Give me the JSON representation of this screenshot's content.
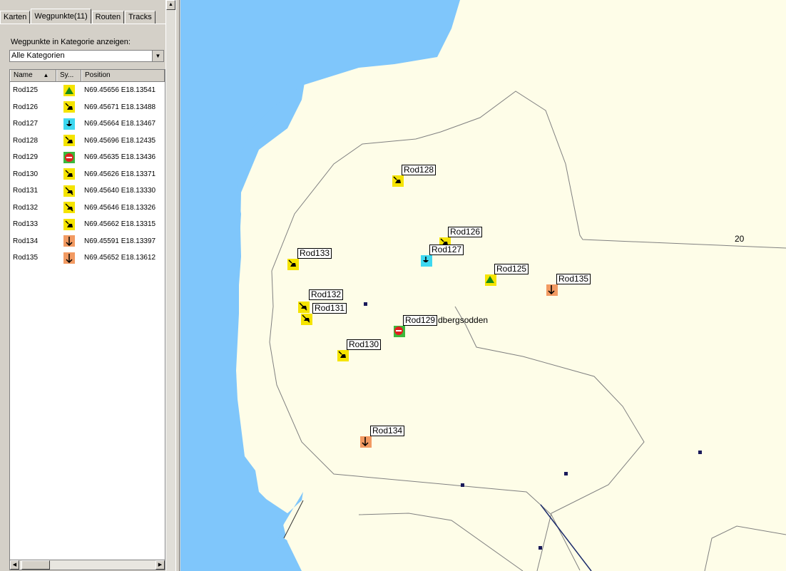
{
  "tabs": [
    {
      "label": "Karten"
    },
    {
      "label": "Wegpunkte(11)"
    },
    {
      "label": "Routen"
    },
    {
      "label": "Tracks"
    }
  ],
  "waypoints_panel": {
    "category_label": "Wegpunkte in Kategorie anzeigen:",
    "category_value": "Alle Kategorien",
    "columns": {
      "name": "Name",
      "symbol": "Sy...",
      "position": "Position"
    },
    "rows": [
      {
        "name": "Rod125",
        "symbol": "park-icon",
        "position": "N69.45656 E18.13541"
      },
      {
        "name": "Rod126",
        "symbol": "dog-icon",
        "position": "N69.45671 E18.13488"
      },
      {
        "name": "Rod127",
        "symbol": "drinking-water-icon",
        "position": "N69.45664 E18.13467"
      },
      {
        "name": "Rod128",
        "symbol": "dog-icon",
        "position": "N69.45696 E18.12435"
      },
      {
        "name": "Rod129",
        "symbol": "no-entry-icon",
        "position": "N69.45635 E18.13436"
      },
      {
        "name": "Rod130",
        "symbol": "dog-icon",
        "position": "N69.45626 E18.13371"
      },
      {
        "name": "Rod131",
        "symbol": "no-dogs-icon",
        "position": "N69.45640 E18.13330"
      },
      {
        "name": "Rod132",
        "symbol": "no-dogs-icon",
        "position": "N69.45646 E18.13326"
      },
      {
        "name": "Rod133",
        "symbol": "dog-icon",
        "position": "N69.45662 E18.13315"
      },
      {
        "name": "Rod134",
        "symbol": "anchor-icon",
        "position": "N69.45591 E18.13397"
      },
      {
        "name": "Rod135",
        "symbol": "anchor-icon",
        "position": "N69.45652 E18.13612"
      }
    ]
  },
  "map": {
    "place_name": "dbergsodden",
    "contour_label": "20",
    "waypoint_labels": {
      "rod125": "Rod125",
      "rod126": "Rod126",
      "rod127": "Rod127",
      "rod128": "Rod128",
      "rod129": "Rod129",
      "rod130": "Rod130",
      "rod131": "Rod131",
      "rod132": "Rod132",
      "rod133": "Rod133",
      "rod134": "Rod134",
      "rod135": "Rod135"
    },
    "colors": {
      "water": "#7fc6fb",
      "land": "#fefde8",
      "symbol_yellow": "#f5e400",
      "symbol_cyan": "#3ed8f0",
      "symbol_orange": "#f29a62",
      "symbol_green": "#3cb83c"
    }
  }
}
